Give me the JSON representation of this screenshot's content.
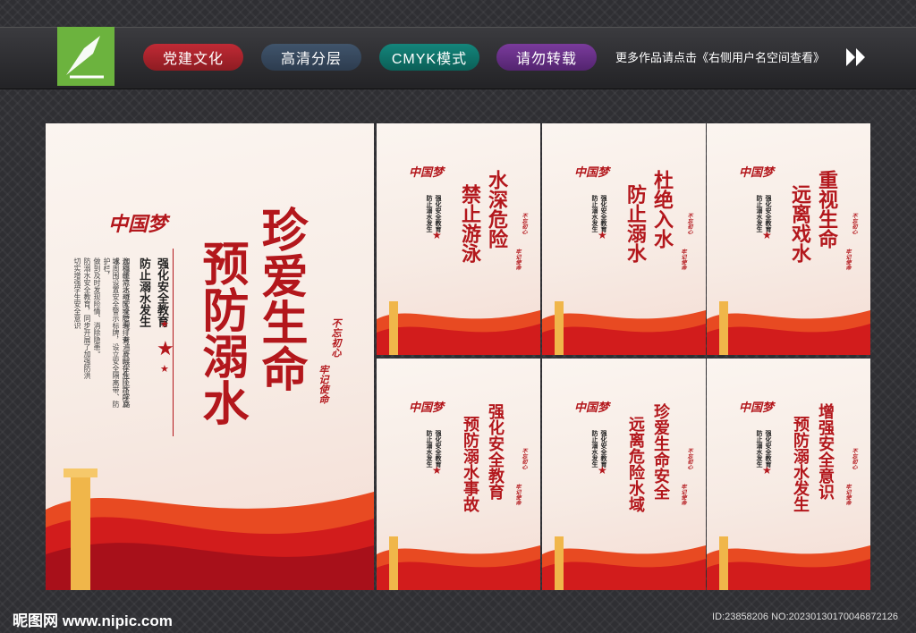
{
  "header": {
    "tags": [
      "党建文化",
      "高清分层",
      "CMYK模式",
      "请勿转载"
    ],
    "more_text": "更多作品请点击《右侧用户名空间查看》"
  },
  "big_poster": {
    "brand": "中国梦",
    "title_col1": "珍爱生命",
    "title_col2": "预防溺水",
    "sub_col1": "强化安全教育",
    "sub_col2": "防止溺水发生",
    "seal_col1": "不忘初心",
    "seal_col2": "牢记使命",
    "body_lines": [
      "加强重点水域安全管理，普遍开展学生上下学路",
      "途和经常活动区域隐患排查，及时在危险路段及水",
      "域周围设置安全警示标牌，设立安全隔离带、防护栏，",
      "做到及时发现险情、消除隐患。",
      "防溺水安全教育，同步开展了加强防洪",
      "切实增强学生安全意识"
    ]
  },
  "small_posters": [
    {
      "col1": "水深危险",
      "col2": "禁止游泳"
    },
    {
      "col1": "杜绝入水",
      "col2": "防止溺水"
    },
    {
      "col1": "重视生命",
      "col2": "远离戏水"
    },
    {
      "col1": "强化安全教育",
      "col2": "预防溺水事故"
    },
    {
      "col1": "珍爱生命安全",
      "col2": "远离危险水域"
    },
    {
      "col1": "增强安全意识",
      "col2": "预防溺水发生"
    }
  ],
  "small_common": {
    "brand": "中国梦",
    "sub_col1": "强化安全教育",
    "sub_col2": "防止溺水发生",
    "seal_col1": "不忘初心",
    "seal_col2": "牢记使命"
  },
  "footer": {
    "site": "昵图网 www.nipic.com",
    "id": "ID:23858206 NO:20230130170046872126"
  },
  "colors": {
    "accent": "#b3171c",
    "logo_green": "#6cb33e"
  }
}
